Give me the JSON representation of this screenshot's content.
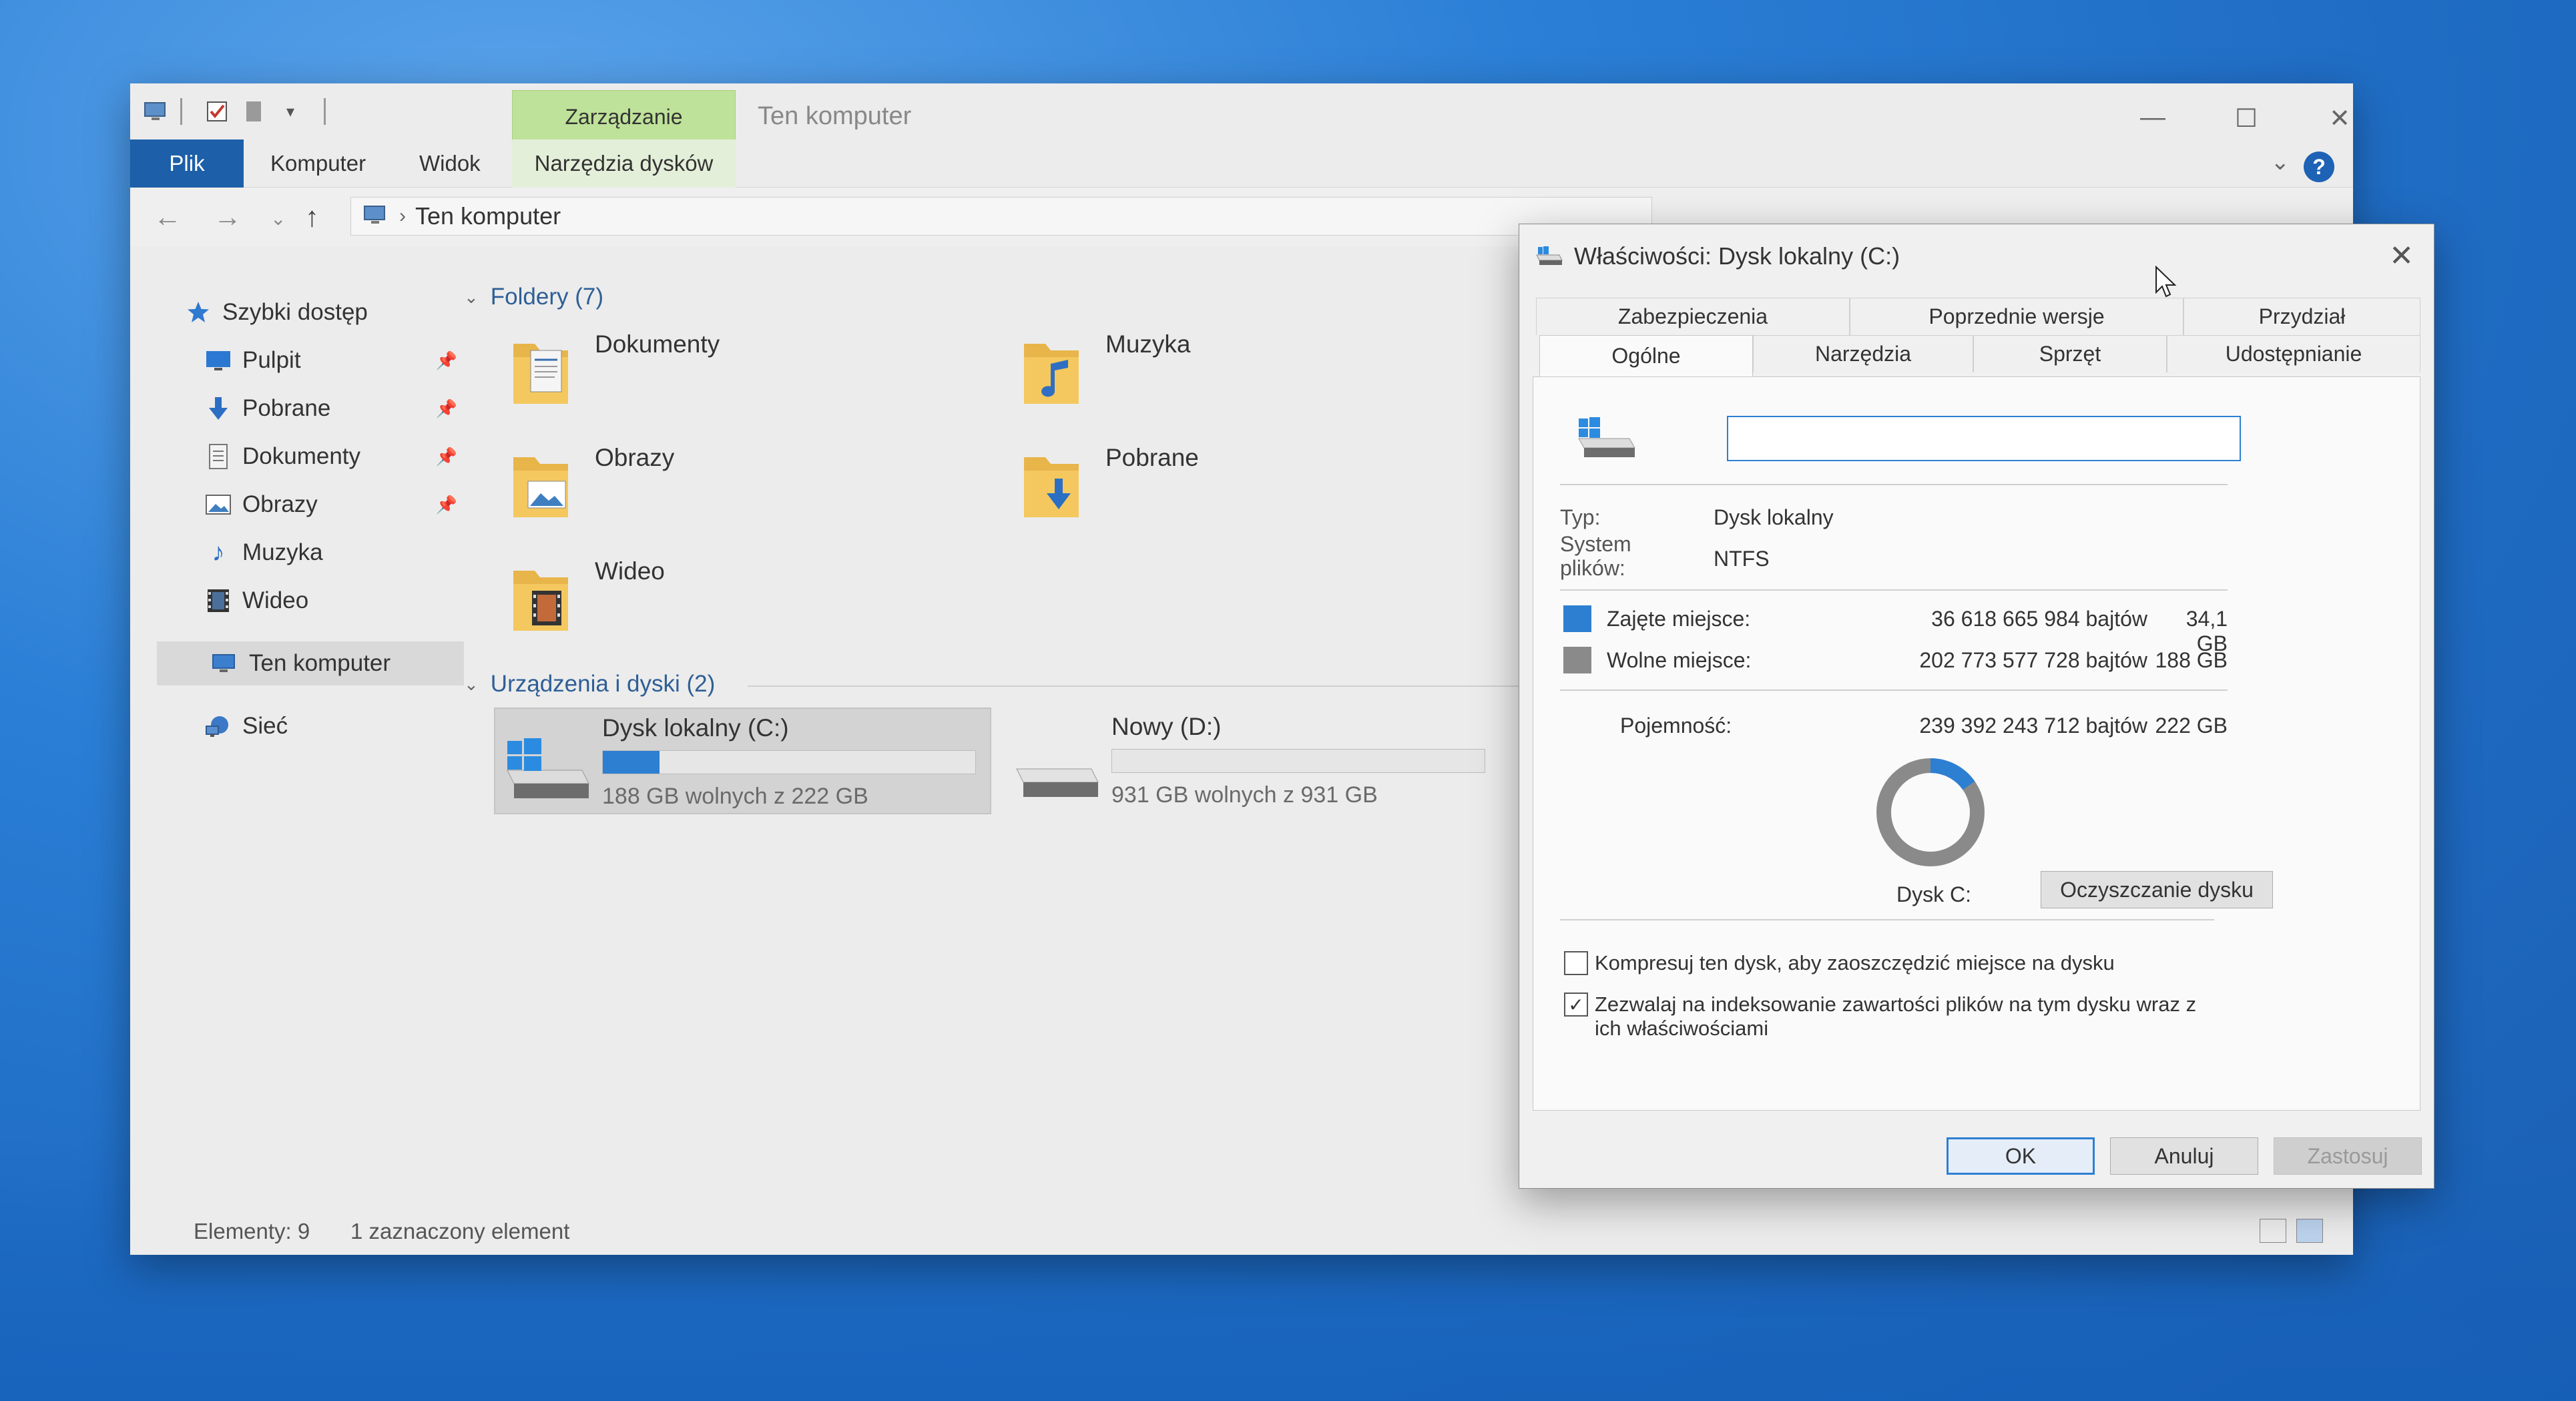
{
  "colors": {
    "accent": "#2d7fd2",
    "file_tab": "#1d5fa8",
    "context_tab": "#bfe29a",
    "used_space": "#2d7fd2",
    "free_space": "#8a8a8a"
  },
  "explorer": {
    "title": "Ten komputer",
    "context_tab": "Zarządzanie",
    "ribbon_tabs": [
      "Plik",
      "Komputer",
      "Widok",
      "Narzędzia dysków"
    ],
    "address_crumb": "Ten komputer",
    "sidebar": {
      "quick_access": "Szybki dostęp",
      "items": [
        {
          "label": "Pulpit",
          "icon": "desktop-icon",
          "pinned": true
        },
        {
          "label": "Pobrane",
          "icon": "download-arrow-icon",
          "pinned": true
        },
        {
          "label": "Dokumenty",
          "icon": "document-icon",
          "pinned": true
        },
        {
          "label": "Obrazy",
          "icon": "picture-icon",
          "pinned": true
        },
        {
          "label": "Muzyka",
          "icon": "music-note-icon",
          "pinned": false
        },
        {
          "label": "Wideo",
          "icon": "film-icon",
          "pinned": false
        }
      ],
      "this_pc": "Ten komputer",
      "network": "Sieć"
    },
    "folders_header": "Foldery (7)",
    "folders": [
      {
        "label": "Dokumenty",
        "icon": "documents-folder-icon"
      },
      {
        "label": "Muzyka",
        "icon": "music-folder-icon"
      },
      {
        "label": "Obrazy",
        "icon": "pictures-folder-icon"
      },
      {
        "label": "Pobrane",
        "icon": "downloads-folder-icon"
      },
      {
        "label": "Wideo",
        "icon": "videos-folder-icon"
      }
    ],
    "devices_header": "Urządzenia i dyski (2)",
    "drives": [
      {
        "name": "Dysk lokalny (C:)",
        "free_text": "188 GB wolnych z 222 GB",
        "used_fraction": 0.153
      },
      {
        "name": "Nowy (D:)",
        "free_text": "931 GB wolnych z 931 GB",
        "used_fraction": 0.0
      }
    ],
    "status": {
      "items": "Elementy: 9",
      "selected": "1 zaznaczony element"
    }
  },
  "dialog": {
    "title": "Właściwości: Dysk lokalny (C:)",
    "tabs_top": [
      "Zabezpieczenia",
      "Poprzednie wersje",
      "Przydział"
    ],
    "tabs_bottom": [
      "Ogólne",
      "Narzędzia",
      "Sprzęt",
      "Udostępnianie"
    ],
    "name_value": "",
    "type_label": "Typ:",
    "type_value": "Dysk lokalny",
    "fs_label_1": "System",
    "fs_label_2": "plików:",
    "fs_value": "NTFS",
    "used_label": "Zajęte miejsce:",
    "used_bytes": "36 618 665 984 bajtów",
    "used_gb": "34,1 GB",
    "free_label": "Wolne miejsce:",
    "free_bytes": "202 773 577 728 bajtów",
    "free_gb": "188 GB",
    "capacity_label": "Pojemność:",
    "capacity_bytes": "239 392 243 712 bajtów",
    "capacity_gb": "222 GB",
    "used_fraction": 0.153,
    "drive_caption": "Dysk C:",
    "cleanup_button": "Oczyszczanie dysku",
    "compress_label": "Kompresuj ten dysk, aby zaoszczędzić miejsce na dysku",
    "compress_checked": false,
    "index_label_1": "Zezwalaj na indeksowanie zawartości plików na tym dysku wraz z",
    "index_label_2": "ich właściwościami",
    "index_checked": true,
    "ok": "OK",
    "cancel": "Anuluj",
    "apply": "Zastosuj"
  }
}
